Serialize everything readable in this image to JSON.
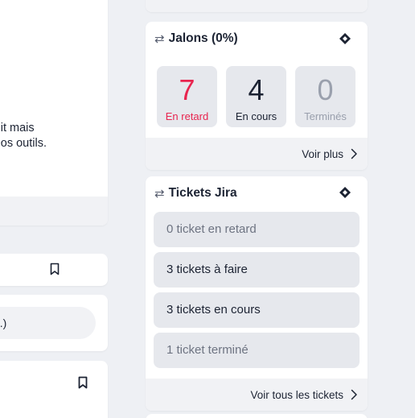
{
  "left": {
    "card1_lines": [
      "it mais",
      "os outils."
    ],
    "card3_pill_text": "...)"
  },
  "jalons": {
    "title": "Jalons (0%)",
    "stats": [
      {
        "value": "7",
        "label": "En retard"
      },
      {
        "value": "4",
        "label": "En cours"
      },
      {
        "value": "0",
        "label": "Terminés"
      }
    ],
    "footer_link": "Voir plus"
  },
  "jira": {
    "title": "Tickets Jira",
    "tickets": [
      "0 ticket en retard",
      "3 tickets à faire",
      "3 tickets en cours",
      "1 ticket terminé"
    ],
    "footer_link": "Voir tous les tickets"
  },
  "colors": {
    "late": "#e8254f",
    "done": "#9aa0ad",
    "text": "#1c2333",
    "background": "#eef0f4"
  }
}
